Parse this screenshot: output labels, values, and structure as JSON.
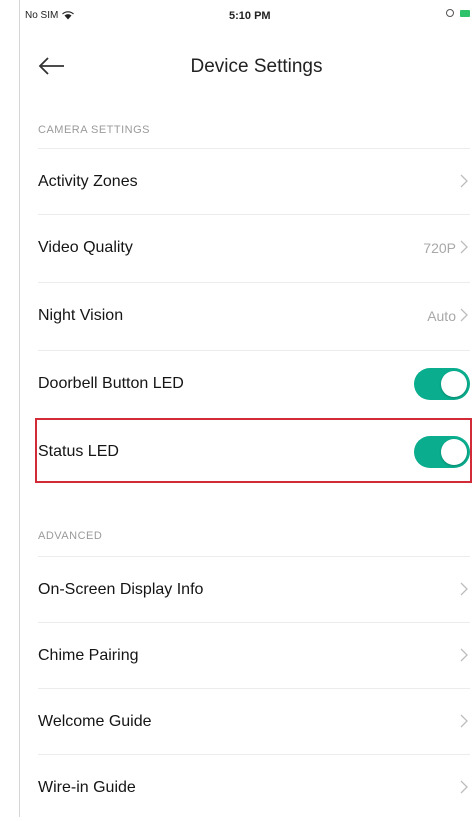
{
  "status_bar": {
    "carrier": "No SIM",
    "time": "5:10 PM"
  },
  "header": {
    "title": "Device Settings"
  },
  "sections": [
    {
      "heading": "CAMERA SETTINGS",
      "rows": [
        {
          "label": "Activity Zones",
          "value": ""
        },
        {
          "label": "Video Quality",
          "value": "720P"
        },
        {
          "label": "Night Vision",
          "value": "Auto"
        },
        {
          "label": "Doorbell Button LED",
          "toggle": true
        },
        {
          "label": "Status LED",
          "toggle": true
        }
      ]
    },
    {
      "heading": "ADVANCED",
      "rows": [
        {
          "label": "On-Screen Display Info"
        },
        {
          "label": "Chime Pairing"
        },
        {
          "label": "Welcome Guide"
        },
        {
          "label": "Wire-in Guide"
        }
      ]
    }
  ],
  "colors": {
    "toggle_on": "#0aae8f",
    "highlight": "#d22a36"
  }
}
